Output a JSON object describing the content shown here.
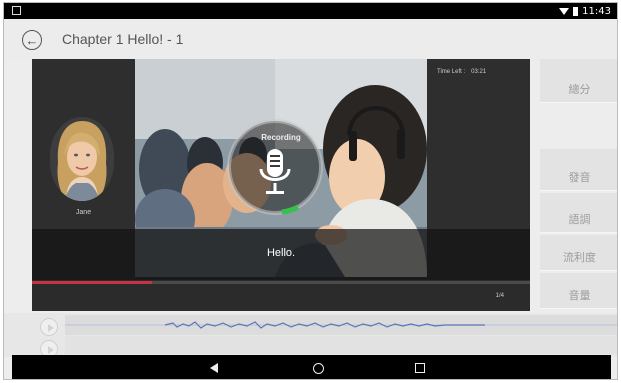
{
  "status_bar": {
    "time": "11:43"
  },
  "header": {
    "title": "Chapter 1 Hello! - 1"
  },
  "speaker": {
    "name": "Jane"
  },
  "timer": {
    "label": "Time Left :",
    "value": "03:21"
  },
  "recording": {
    "label": "Recording"
  },
  "caption": {
    "text": "Hello."
  },
  "progress": {
    "fraction": 0.24,
    "page": "1/4"
  },
  "scores": {
    "total": "總分",
    "pronunciation": "發音",
    "intonation": "語調",
    "fluency": "流利度",
    "volume": "音量"
  },
  "colors": {
    "accent_red": "#c53446",
    "mic_green": "#33c24a"
  },
  "icons": {
    "back": "arrow-left-icon",
    "mic": "microphone-icon",
    "play": "play-icon"
  }
}
